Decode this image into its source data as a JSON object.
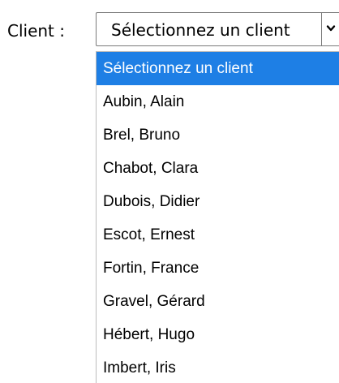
{
  "form": {
    "client_label": "Client :"
  },
  "client_select": {
    "selected_value": "Sélectionnez un client",
    "icon": "chevron-down-icon",
    "options": [
      "Sélectionnez un client",
      "Aubin, Alain",
      "Brel, Bruno",
      "Chabot, Clara",
      "Dubois, Didier",
      "Escot, Ernest",
      "Fortin, France",
      "Gravel, Gérard",
      "Hébert, Hugo",
      "Imbert, Iris"
    ],
    "highlighted_index": 0
  },
  "colors": {
    "highlight": "#1e7fe5",
    "highlight_text": "#ffffff"
  }
}
